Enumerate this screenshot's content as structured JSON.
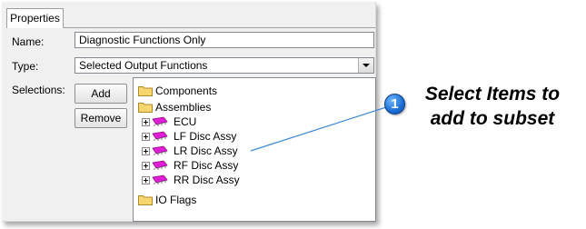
{
  "tab": {
    "label": "Properties"
  },
  "name_field": {
    "label": "Name:",
    "value": "Diagnostic Functions Only"
  },
  "type_field": {
    "label": "Type:",
    "value": "Selected Output Functions"
  },
  "selections": {
    "label": "Selections:",
    "add_label": "Add",
    "remove_label": "Remove"
  },
  "tree": {
    "components": "Components",
    "assemblies": "Assemblies",
    "items": [
      "ECU",
      "LF Disc Assy",
      "LR Disc Assy",
      "RF Disc Assy",
      "RR Disc Assy"
    ],
    "io_flags": "IO Flags"
  },
  "callout": {
    "number": "1",
    "line1": "Select Items to",
    "line2": "add to subset"
  },
  "colors": {
    "badge": "#1a6ed6",
    "leader_line": "#3a8ad8",
    "chip": "#e01fd4",
    "folder": "#f5d76e"
  }
}
